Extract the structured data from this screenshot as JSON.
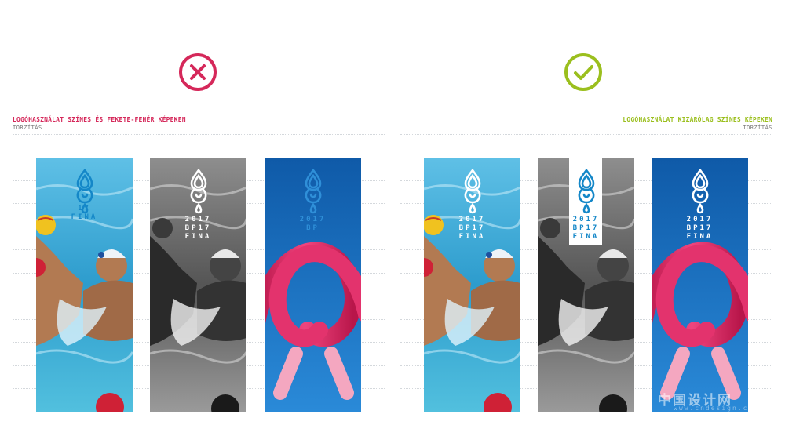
{
  "colors": {
    "wrong": "#d5285a",
    "correct": "#9bbf1e",
    "fina_blue": "#1487c8",
    "pool_blue": "#3aa9d9",
    "ribbon_pink": "#d9245e",
    "panel_blue": "#1063b8"
  },
  "left": {
    "status_icon": "x-circle-icon",
    "heading": "LOGÓHASZNÁLAT SZÍNES ÉS FEKETE-FEHÉR KÉPEKEN",
    "subheading": "TORZÍTÁS",
    "panels": [
      {
        "logo": {
          "lines": [
            "",
            "17",
            "FINA"
          ]
        }
      },
      {
        "logo": {
          "lines": [
            "2017",
            "BP17",
            "FINA"
          ]
        }
      },
      {
        "logo": {
          "lines": [
            "2017",
            "BP",
            ""
          ]
        }
      }
    ]
  },
  "right": {
    "status_icon": "check-circle-icon",
    "heading": "LOGÓHASZNÁLAT KIZÁRÓLAG SZÍNES KÉPEKEN",
    "subheading": "TORZÍTÁS",
    "panels": [
      {
        "logo": {
          "lines": [
            "2017",
            "BP17",
            "FINA"
          ]
        }
      },
      {
        "logo": {
          "lines": [
            "2017",
            "BP17",
            "FINA"
          ]
        }
      },
      {
        "logo": {
          "lines": [
            "2017",
            "BP17",
            "FINA"
          ]
        }
      }
    ]
  },
  "watermark": {
    "text": "中国设计网",
    "sub": "www.cndesign.com"
  }
}
